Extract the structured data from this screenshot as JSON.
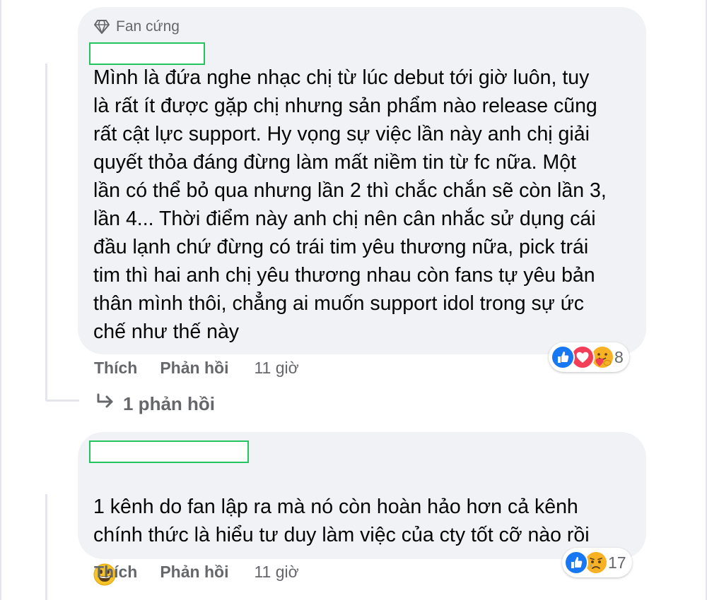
{
  "comment1": {
    "badge": "Fan cứng",
    "text": "Mình là đứa nghe nhạc chị từ lúc debut tới giờ luôn, tuy\nlà rất ít được gặp chị nhưng sản phẩm nào release cũng\nrất cật lực support. Hy vọng sự việc lần này anh chị giải\nquyết thỏa đáng đừng làm mất niềm tin từ fc nữa. Một\nlần có thể bỏ qua nhưng lần 2 thì chắc chắn sẽ còn lần 3,\nlần 4... Thời điểm này anh chị nên cân nhắc sử dụng cái\nđầu lạnh chứ đừng có trái tim yêu thương nữa, pick trái\ntim thì hai anh chị yêu thương nhau còn fans tự yêu bản\nthân mình thôi, chẳng ai muốn support idol trong sự ức\nchế như thế này",
    "like_label": "Thích",
    "reply_label": "Phản hồi",
    "time": "11 giờ",
    "reaction_icons": [
      "like-icon",
      "love-icon",
      "care-icon"
    ],
    "reaction_count": "8",
    "replies_link": "1 phản hồi"
  },
  "comment2": {
    "text": "1 kênh do fan lập ra mà nó còn hoàn hảo hơn cả kênh\nchính thức là hiểu tư duy làm việc của cty tốt cỡ nào rồi",
    "emoji": "grinning-face-emoji",
    "like_label": "Thích",
    "reply_label": "Phản hồi",
    "time": "11 giờ",
    "reaction_icons": [
      "like-icon",
      "sad-icon"
    ],
    "reaction_count": "17"
  },
  "colors": {
    "bubble": "#f0f2f5",
    "secondary_text": "#65676b",
    "like_blue": "#1877f2",
    "love_red": "#f33e58",
    "name_redaction_border": "#22c55e"
  }
}
